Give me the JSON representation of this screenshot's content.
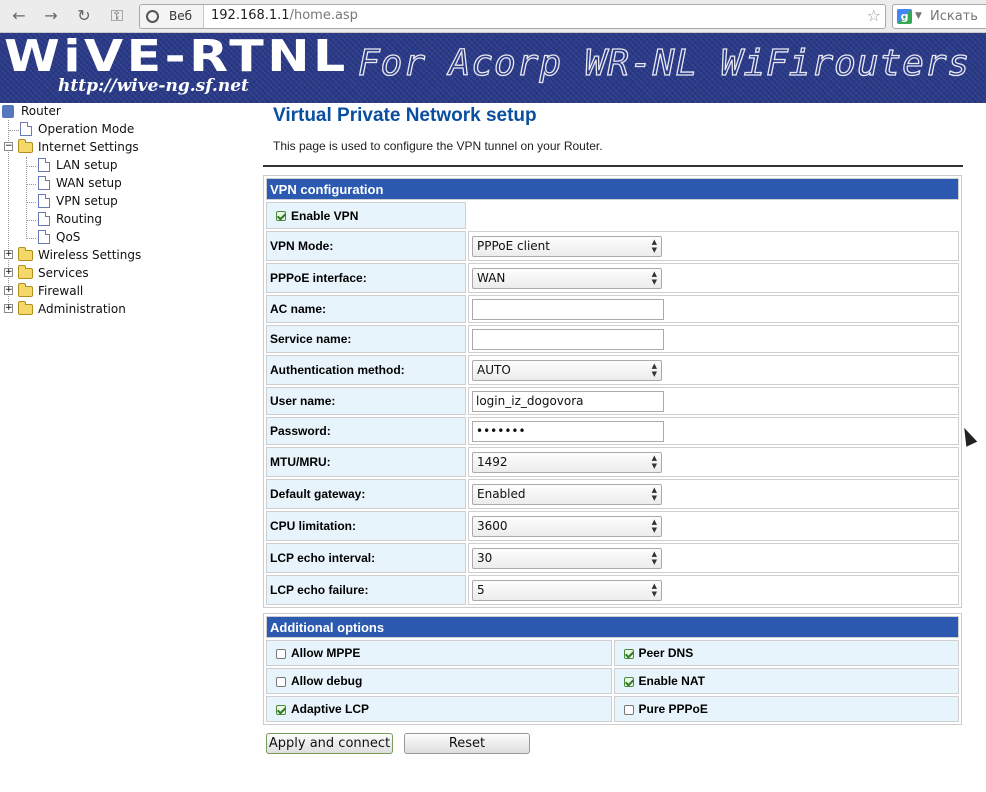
{
  "browser": {
    "url_chip": "Веб",
    "url_host": "192.168.1.1",
    "url_path": "/home.asp",
    "search_placeholder": "Искать"
  },
  "banner": {
    "brand": "WiVE-RTNL",
    "tagline": "For Acorp WR-NL WiFirouters",
    "site_url": "http://wive-ng.sf.net"
  },
  "sidebar": {
    "root": "Router",
    "items": [
      {
        "label": "Operation Mode"
      },
      {
        "label": "Internet Settings"
      },
      {
        "label": "LAN setup"
      },
      {
        "label": "WAN setup"
      },
      {
        "label": "VPN setup"
      },
      {
        "label": "Routing"
      },
      {
        "label": "QoS"
      },
      {
        "label": "Wireless Settings"
      },
      {
        "label": "Services"
      },
      {
        "label": "Firewall"
      },
      {
        "label": "Administration"
      }
    ]
  },
  "page": {
    "title": "Virtual Private Network setup",
    "description": "This page is used to configure the VPN tunnel on your Router."
  },
  "vpn": {
    "header": "VPN configuration",
    "enable_label": "Enable VPN",
    "enable_checked": true,
    "fields": [
      {
        "label": "VPN Mode:",
        "value": "PPPoE client"
      },
      {
        "label": "PPPoE interface:",
        "value": "WAN"
      },
      {
        "label": "AC name:",
        "value": ""
      },
      {
        "label": "Service name:",
        "value": ""
      },
      {
        "label": "Authentication method:",
        "value": "AUTO"
      },
      {
        "label": "User name:",
        "value": "login_iz_dogovora"
      },
      {
        "label": "Password:",
        "value": "•••••••"
      },
      {
        "label": "MTU/MRU:",
        "value": "1492"
      },
      {
        "label": "Default gateway:",
        "value": "Enabled"
      },
      {
        "label": "CPU limitation:",
        "value": "3600"
      },
      {
        "label": "LCP echo interval:",
        "value": "30"
      },
      {
        "label": "LCP echo failure:",
        "value": "5"
      }
    ]
  },
  "additional": {
    "header": "Additional options",
    "options": [
      {
        "label": "Allow MPPE",
        "checked": false
      },
      {
        "label": "Peer DNS",
        "checked": true
      },
      {
        "label": "Allow debug",
        "checked": false
      },
      {
        "label": "Enable NAT",
        "checked": true
      },
      {
        "label": "Adaptive LCP",
        "checked": true
      },
      {
        "label": "Pure PPPoE",
        "checked": false
      }
    ]
  },
  "buttons": {
    "apply": "Apply and connect",
    "reset": "Reset"
  }
}
